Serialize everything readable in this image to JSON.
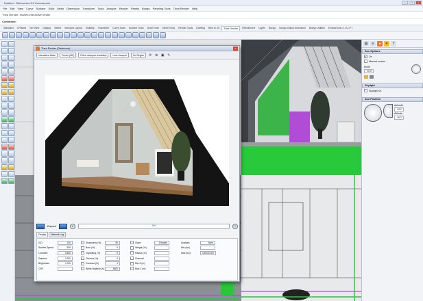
{
  "window": {
    "title": "Untitled - Rhinoceros 5.0 Commercial",
    "controls": [
      "–",
      "□",
      "×"
    ]
  },
  "menu": [
    "File",
    "Edit",
    "View",
    "Curve",
    "Surface",
    "Solid",
    "Mesh",
    "Dimension",
    "Transform",
    "Tools",
    "Analyze",
    "Render",
    "Panels",
    "Bongo",
    "Paneling Tools",
    "Thea Render",
    "Help"
  ],
  "command": {
    "history": "Thea Render: Started interactive render",
    "prompt": "Command:"
  },
  "toolbar_tabs": [
    "Standard",
    "CPlanes",
    "Set View",
    "Display",
    "Select",
    "Viewport Layout",
    "Visibility",
    "Transform",
    "Curve Tools",
    "Surface Tools",
    "Solid Tools",
    "Mesh Tools",
    "Render Tools",
    "Drafting",
    "New in V5",
    "Thea Render",
    "RhinoDrone",
    "Lights",
    "Bongo",
    "Bongo Object Animation",
    "Bongo Utilities",
    "EvaluaTools 3.1 LCFT"
  ],
  "active_toolbar_tab": "Thea Render",
  "render_window": {
    "title": "Thea Render (Darkroom)",
    "mode": "Interactive Mode",
    "preset": "Presto (MC)",
    "resolution": "Rhino viewport resolution",
    "viewport": "Lock viewport",
    "no_region": "No Region",
    "button_elapsed": "Elapsed",
    "progress": "0%",
    "tabs": [
      "Display",
      "Network Log"
    ],
    "active_tab": "Display",
    "display_settings": [
      {
        "label": "ISO",
        "value": "200"
      },
      {
        "label": "Shutter Speed",
        "value": "500"
      },
      {
        "label": "f-number",
        "value": "5.600"
      },
      {
        "label": "Gamma",
        "value": "2.200"
      },
      {
        "label": "Brightness",
        "value": "1.000"
      },
      {
        "label": "CRF",
        "value": ""
      }
    ],
    "tone_settings": [
      {
        "label": "Sharpness (%)",
        "value": "50"
      },
      {
        "label": "Burn (%)",
        "value": "0"
      },
      {
        "label": "Vignetting (%)",
        "value": "0"
      },
      {
        "label": "Chroma (%)",
        "value": "0"
      },
      {
        "label": "Contrast (%)",
        "value": "0"
      },
      {
        "label": "White Balance (K)",
        "value": "6500"
      }
    ],
    "glare_settings": [
      {
        "label": "Glare",
        "value": "3 Blades"
      },
      {
        "label": "Weight (%)",
        "value": ""
      },
      {
        "label": "Radius (%)",
        "value": ""
      },
      {
        "label": "Channel",
        "value": ""
      },
      {
        "label": "Min Z (m)",
        "value": ""
      },
      {
        "label": "Max Z (m)",
        "value": ""
      }
    ],
    "analysis_settings": [
      {
        "label": "Analysis",
        "value": "None"
      },
      {
        "label": "Min (lux)",
        "value": ""
      },
      {
        "label": "Max (lux)",
        "value": "100000.000"
      }
    ]
  },
  "right_panel": {
    "tab_icons": [
      "properties-icon",
      "layers-icon",
      "render-icon",
      "sun-icon",
      "help-icon"
    ],
    "sun_options": {
      "header": "Sun Options",
      "on_label": "On",
      "manual_control": "Manual control",
      "north_label": "North",
      "north_value": "90.0°"
    },
    "skylight": {
      "header": "Skylight",
      "on_label": "Skylight On"
    },
    "sun_position": {
      "header": "Sun Position",
      "azimuth_label": "Azimuth",
      "azimuth_value": "92.1°",
      "altitude_label": "Altitude",
      "altitude_value": "46.2°"
    }
  },
  "colors": {
    "accent_blue": "#1f5ea8",
    "viewport_green": "#29c63b",
    "selection_purple": "#b04cd6"
  }
}
